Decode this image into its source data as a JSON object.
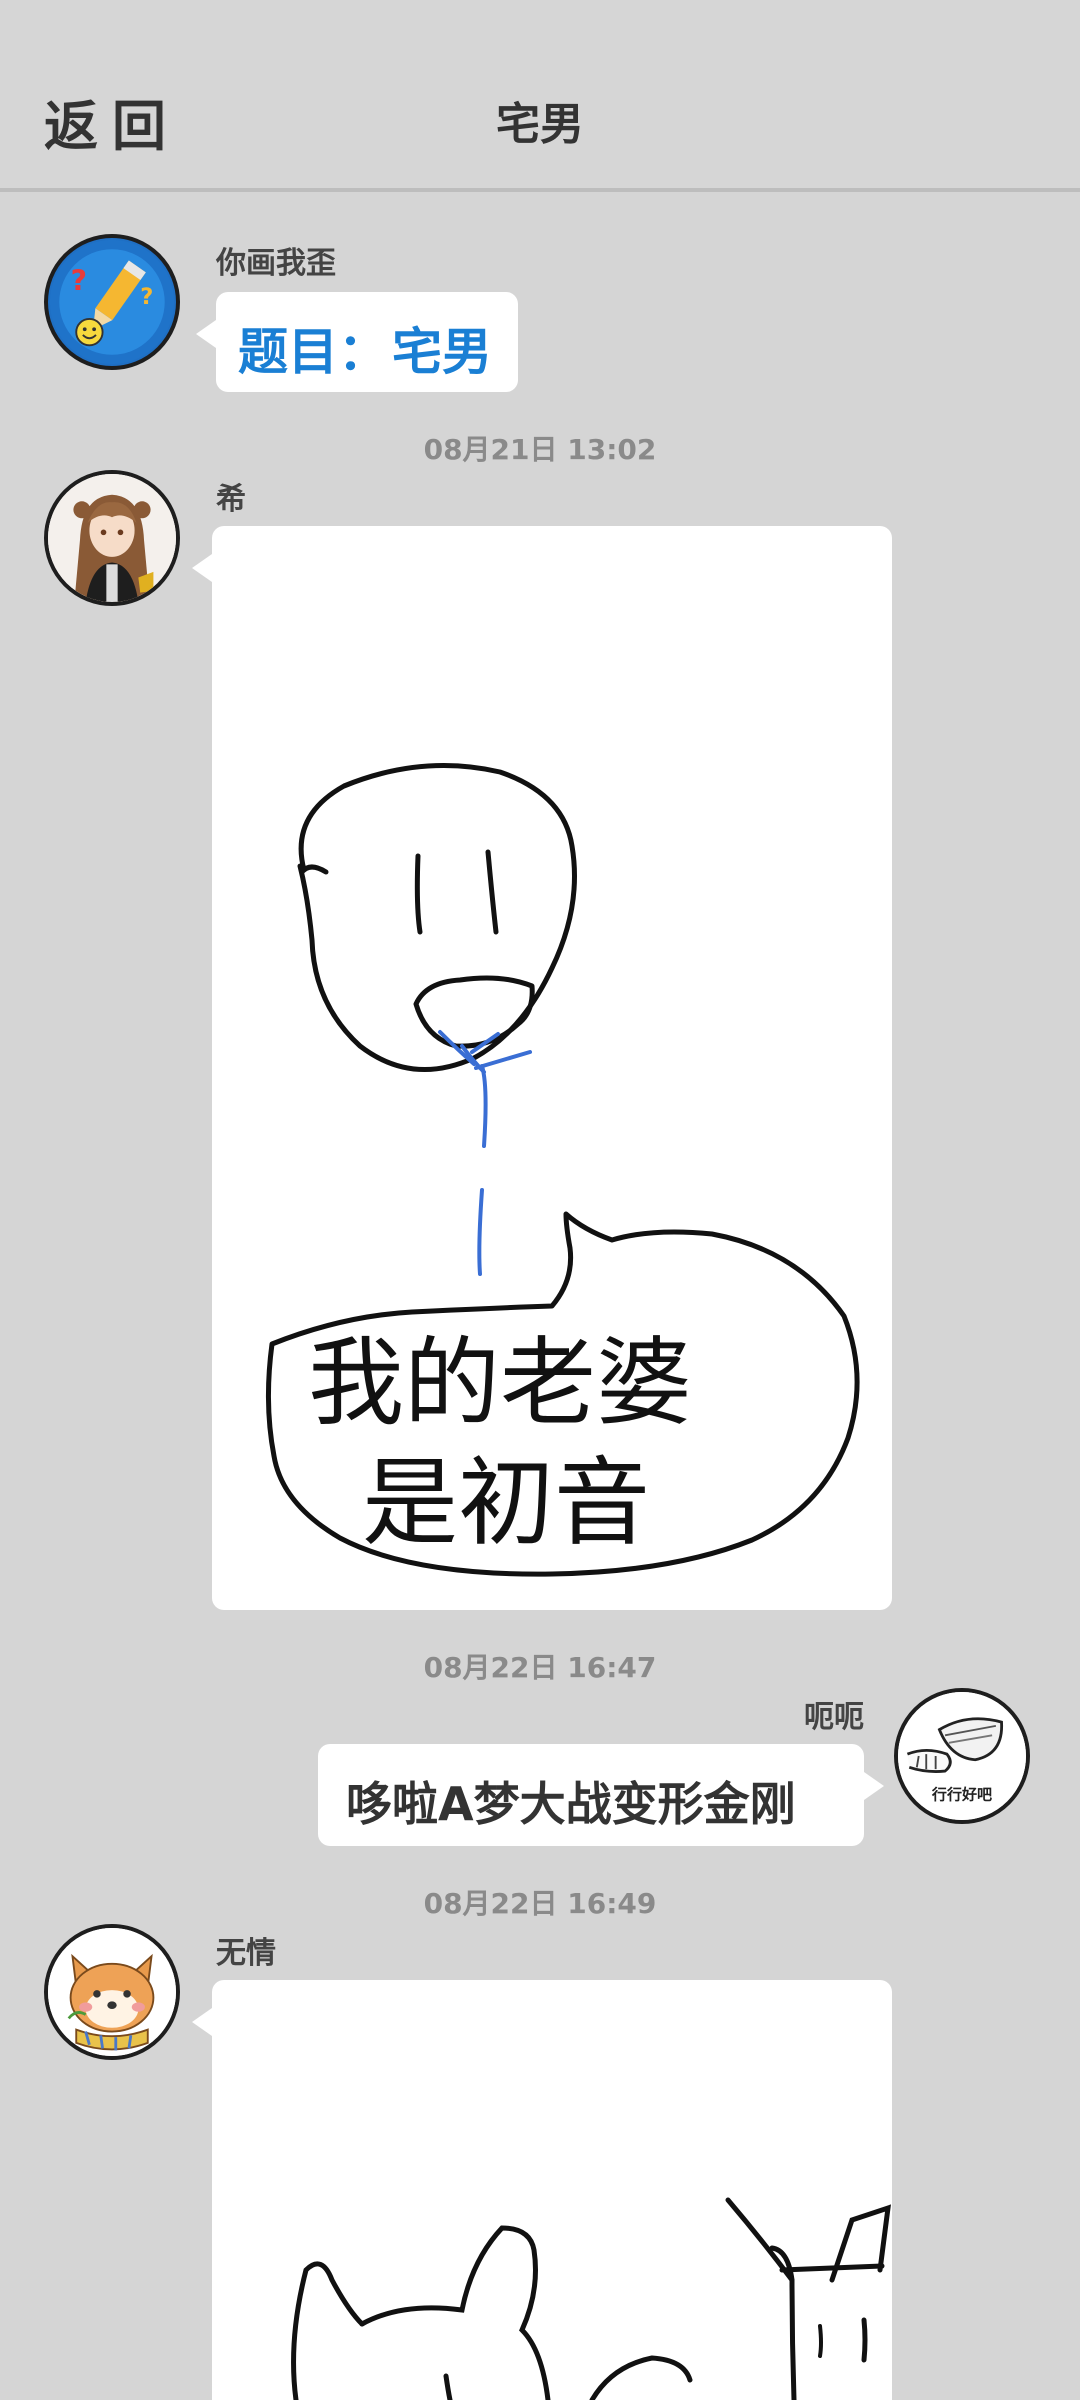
{
  "header": {
    "back_label": "返回",
    "title": "宅男"
  },
  "messages": [
    {
      "sender": "你画我歪",
      "type": "text",
      "prompt_label": "题目：",
      "prompt_word": "宅男",
      "avatar_icon": "pencil-game-logo-icon"
    },
    {
      "timestamp": "08月21日  13:02",
      "sender": "希",
      "type": "drawing",
      "drawing_text_line1": "我的老婆",
      "drawing_text_line2": "是初音",
      "avatar_icon": "anime-girl-avatar-icon"
    },
    {
      "timestamp": "08月22日  16:47",
      "sender": "呃呃",
      "type": "text",
      "text": "哆啦A梦大战变形金刚",
      "avatar_icon": "bowl-hand-avatar-icon",
      "avatar_caption": "行行好吧"
    },
    {
      "timestamp": "08月22日  16:49",
      "sender": "无情",
      "type": "drawing",
      "avatar_icon": "shiba-dog-avatar-icon"
    }
  ],
  "colors": {
    "background": "#d5d5d5",
    "prompt_blue": "#1a7fd4",
    "text_dark": "#333333",
    "timestamp_gray": "#8a8a8a"
  }
}
